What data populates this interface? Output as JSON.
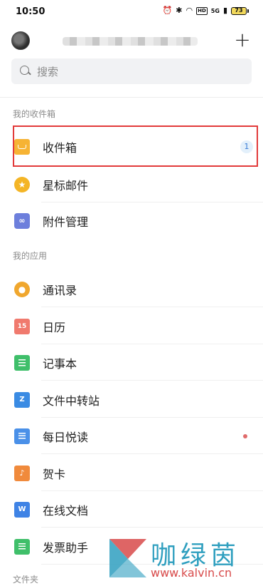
{
  "status_bar": {
    "time": "10:50",
    "network": "5G",
    "hd": "HD",
    "battery": "73"
  },
  "header": {
    "add_symbol": "+"
  },
  "search": {
    "placeholder": "搜索"
  },
  "sections": {
    "mailbox": "我的收件箱",
    "apps": "我的应用",
    "folders": "文件夹"
  },
  "mailbox_items": [
    {
      "label": "收件箱",
      "icon": "inbox-icon",
      "badge": "1"
    },
    {
      "label": "星标邮件",
      "icon": "star-icon"
    },
    {
      "label": "附件管理",
      "icon": "attachment-icon"
    }
  ],
  "app_items": [
    {
      "label": "通讯录",
      "icon": "contacts-icon"
    },
    {
      "label": "日历",
      "icon": "calendar-icon",
      "icon_text": "15"
    },
    {
      "label": "记事本",
      "icon": "notes-icon"
    },
    {
      "label": "文件中转站",
      "icon": "file-transfer-icon",
      "icon_text": "Z"
    },
    {
      "label": "每日悦读",
      "icon": "daily-reading-icon",
      "has_dot": true
    },
    {
      "label": "贺卡",
      "icon": "greeting-card-icon",
      "icon_text": "♪"
    },
    {
      "label": "在线文档",
      "icon": "online-docs-icon",
      "icon_text": "W"
    },
    {
      "label": "发票助手",
      "icon": "invoice-icon"
    }
  ],
  "watermark": {
    "brand": "咖绿茵",
    "url": "www.kalvin.cn"
  },
  "colors": {
    "highlight": "#e23a3a",
    "badge_text": "#3a7bd5",
    "watermark_text": "#2f9fbf",
    "watermark_url": "#d84a4a"
  }
}
